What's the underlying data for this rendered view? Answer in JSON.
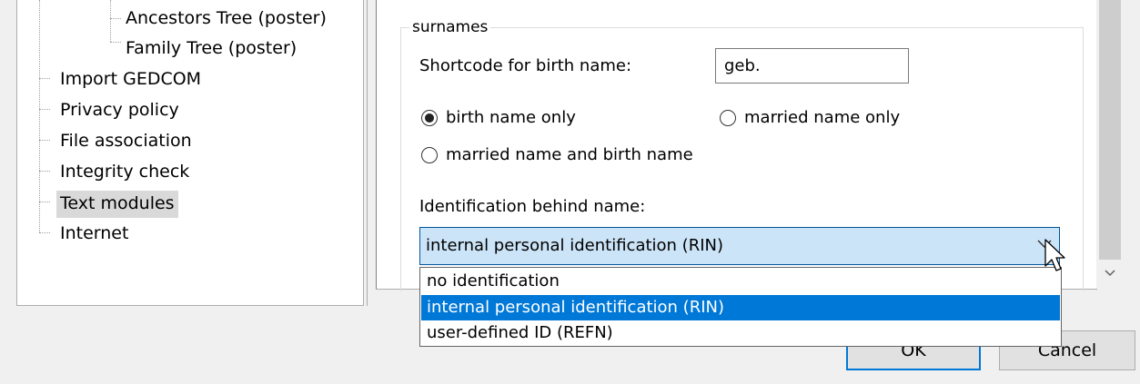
{
  "tree": {
    "items": [
      {
        "label": "Ancestors Tree (poster)",
        "level": 2
      },
      {
        "label": "Family Tree (poster)",
        "level": 2
      },
      {
        "label": "Import GEDCOM",
        "level": 1
      },
      {
        "label": "Privacy policy",
        "level": 1
      },
      {
        "label": "File association",
        "level": 1
      },
      {
        "label": "Integrity check",
        "level": 1
      },
      {
        "label": "Text modules",
        "level": 1,
        "selected": true
      },
      {
        "label": "Internet",
        "level": 1
      }
    ]
  },
  "surnames": {
    "group_title": "surnames",
    "shortcode_label": "Shortcode for birth name:",
    "shortcode_value": "geb.",
    "radio_birth_only": "birth name only",
    "radio_married_only": "married name only",
    "radio_married_and_birth": "married name and birth name",
    "selected_radio": "birth name only",
    "identification_label": "Identification behind name:",
    "identification_value": "internal personal identification (RIN)",
    "identification_options": [
      "no identification",
      "internal personal identification (RIN)",
      "user-defined ID (REFN)"
    ]
  },
  "buttons": {
    "ok": "OK",
    "cancel": "Cancel"
  },
  "colors": {
    "selection": "#0078d7",
    "combo_focus_bg": "#cce4f7",
    "tree_selected_bg": "#d9d9d9"
  }
}
